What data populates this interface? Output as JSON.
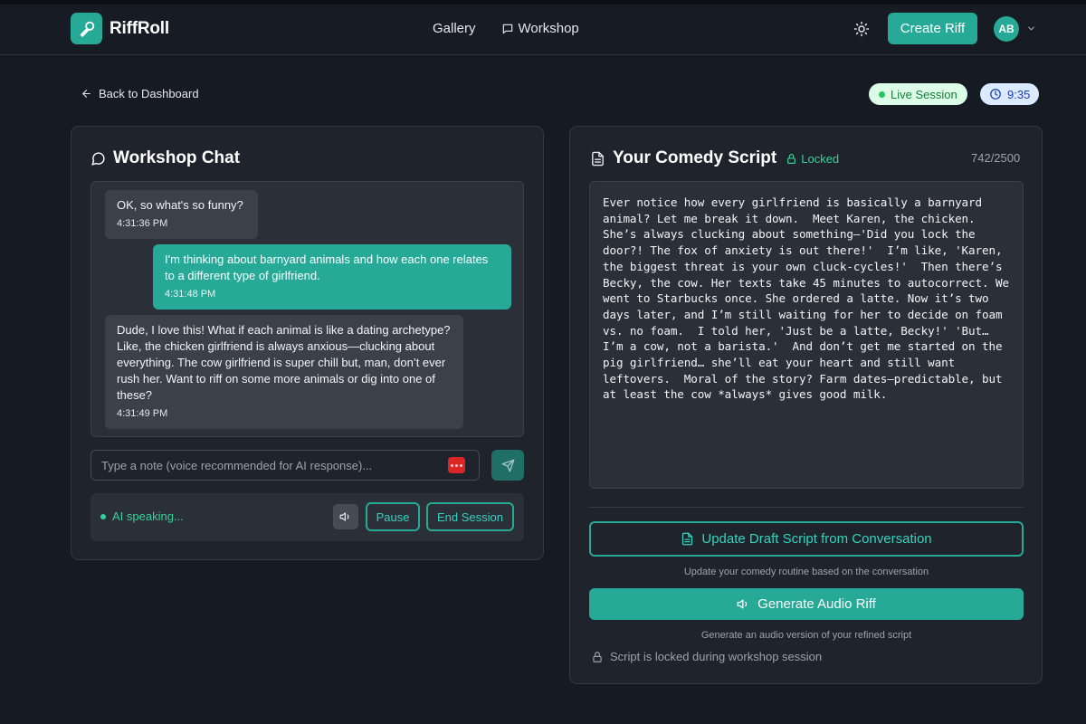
{
  "app": {
    "name": "RiffRoll"
  },
  "nav": {
    "gallery": "Gallery",
    "workshop": "Workshop"
  },
  "header": {
    "create_label": "Create Riff",
    "avatar_initials": "AB"
  },
  "subbar": {
    "back_label": "Back to Dashboard",
    "live_label": "Live Session",
    "timer": "9:35"
  },
  "chat": {
    "title": "Workshop Chat",
    "messages": [
      {
        "role": "ai",
        "text": "OK, so what's so funny?",
        "time": "4:31:36 PM"
      },
      {
        "role": "user",
        "text": "I'm thinking about barnyard animals and how each one relates to a different type of girlfriend.",
        "time": "4:31:48 PM"
      },
      {
        "role": "ai",
        "text": "Dude, I love this! What if each animal is like a dating archetype? Like, the chicken girlfriend is always anxious—clucking about everything. The cow girlfriend is super chill but, man, don’t ever rush her. Want to riff on some more animals or dig into one of these?",
        "time": "4:31:49 PM"
      }
    ],
    "input_placeholder": "Type a note (voice recommended for AI response)...",
    "status": "AI speaking...",
    "pause_label": "Pause",
    "end_label": "End Session"
  },
  "script": {
    "title": "Your Comedy Script",
    "locked_label": "Locked",
    "char_count": "742/2500",
    "text": "Ever notice how every girlfriend is basically a barnyard animal? Let me break it down.  Meet Karen, the chicken. She’s always clucking about something—'Did you lock the door?! The fox of anxiety is out there!'  I’m like, 'Karen, the biggest threat is your own cluck-cycles!'  Then there’s Becky, the cow. Her texts take 45 minutes to autocorrect. We went to Starbucks once. She ordered a latte. Now it’s two days later, and I’m still waiting for her to decide on foam vs. no foam.  I told her, 'Just be a latte, Becky!' 'But… I’m a cow, not a barista.'  And don’t get me started on the pig girlfriend… she’ll eat your heart and still want leftovers.  Moral of the story? Farm dates—predictable, but at least the cow *always* gives good milk.",
    "update_label": "Update Draft Script from Conversation",
    "update_caption": "Update your comedy routine based on the conversation",
    "generate_label": "Generate Audio Riff",
    "generate_caption": "Generate an audio version of your refined script",
    "lock_note": "Script is locked during workshop session"
  },
  "icons": {
    "logo": "microphone-icon",
    "workshop": "chat-bubble-icon",
    "theme": "sun-icon",
    "back": "arrow-left-icon",
    "timer": "clock-icon",
    "chat_title": "message-circle-icon",
    "send": "send-icon",
    "volume": "volume-icon",
    "script_title": "file-text-icon",
    "lock": "lock-icon"
  },
  "colors": {
    "accent": "#26a997",
    "background": "#161a22",
    "panel": "#1f232b",
    "live_green": "#22c55e",
    "recording_red": "#dc2626"
  }
}
